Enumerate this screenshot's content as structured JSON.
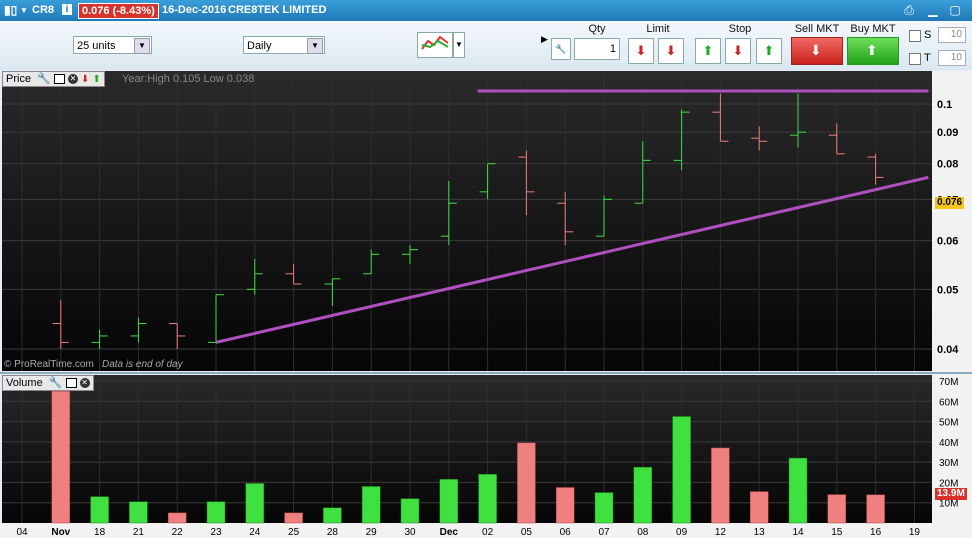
{
  "window": {
    "ticker": "CR8",
    "price_change": "0.076 (-8.43%)",
    "date": "16-Dec-2016",
    "company": "CRE8TEK LIMITED",
    "info_label": "i"
  },
  "toolbar": {
    "units_value": "25 units",
    "period_value": "Daily",
    "qty_label": "Qty",
    "qty_value": "1",
    "limit_label": "Limit",
    "stop_label": "Stop",
    "sell_label": "Sell MKT",
    "buy_label": "Buy MKT",
    "s_label": "S",
    "t_label": "T",
    "s_value": "10",
    "t_value": "10"
  },
  "price_panel": {
    "label": "Price",
    "year_info": "Year:High 0.105 Low 0.038",
    "footer": "© ProRealTime.com",
    "footer_note": "Data is end of day",
    "last_price_box": "0.076"
  },
  "volume_panel": {
    "label": "Volume",
    "last_volume_box": "13.9M"
  },
  "colors": {
    "up": "#3fe03f",
    "down": "#f08080",
    "trendline": "#b04fc0",
    "background": "#000000",
    "price_box": "#f5c518",
    "volume_box": "#d9322b"
  },
  "chart_data": {
    "type": "bar",
    "title": "",
    "x_ticks": [
      "04",
      "Nov",
      "18",
      "21",
      "22",
      "23",
      "24",
      "25",
      "28",
      "29",
      "30",
      "Dec",
      "02",
      "05",
      "06",
      "07",
      "08",
      "09",
      "12",
      "13",
      "14",
      "15",
      "16",
      "19"
    ],
    "price_ticks": [
      "0.04",
      "0.05",
      "0.06",
      "0.07",
      "0.08",
      "0.09",
      "0.1"
    ],
    "price_ylim": [
      0.037,
      0.11
    ],
    "price_scale": "log",
    "volume_ticks": [
      "10M",
      "20M",
      "30M",
      "40M",
      "50M",
      "60M",
      "70M"
    ],
    "volume_ylim": [
      0,
      70
    ],
    "volume_unit": "M",
    "bars": [
      {
        "date": "Nov",
        "open": 0.044,
        "high": 0.048,
        "low": 0.04,
        "close": 0.041,
        "volume": 65
      },
      {
        "date": "18",
        "open": 0.041,
        "high": 0.043,
        "low": 0.04,
        "close": 0.042,
        "volume": 13
      },
      {
        "date": "21",
        "open": 0.042,
        "high": 0.045,
        "low": 0.041,
        "close": 0.044,
        "volume": 10.5
      },
      {
        "date": "22",
        "open": 0.044,
        "high": 0.044,
        "low": 0.04,
        "close": 0.042,
        "volume": 5
      },
      {
        "date": "23",
        "open": 0.041,
        "high": 0.049,
        "low": 0.041,
        "close": 0.049,
        "volume": 10.5
      },
      {
        "date": "24",
        "open": 0.05,
        "high": 0.056,
        "low": 0.049,
        "close": 0.053,
        "volume": 19.5
      },
      {
        "date": "25",
        "open": 0.053,
        "high": 0.055,
        "low": 0.051,
        "close": 0.051,
        "volume": 5
      },
      {
        "date": "28",
        "open": 0.051,
        "high": 0.052,
        "low": 0.047,
        "close": 0.052,
        "volume": 7.5
      },
      {
        "date": "29",
        "open": 0.053,
        "high": 0.058,
        "low": 0.053,
        "close": 0.057,
        "volume": 18
      },
      {
        "date": "30",
        "open": 0.057,
        "high": 0.059,
        "low": 0.055,
        "close": 0.058,
        "volume": 12
      },
      {
        "date": "Dec",
        "open": 0.061,
        "high": 0.075,
        "low": 0.059,
        "close": 0.069,
        "volume": 21.5
      },
      {
        "date": "02",
        "open": 0.072,
        "high": 0.08,
        "low": 0.07,
        "close": 0.08,
        "volume": 24
      },
      {
        "date": "05",
        "open": 0.082,
        "high": 0.084,
        "low": 0.066,
        "close": 0.072,
        "volume": 39.5
      },
      {
        "date": "06",
        "open": 0.069,
        "high": 0.072,
        "low": 0.059,
        "close": 0.062,
        "volume": 17.5
      },
      {
        "date": "07",
        "open": 0.061,
        "high": 0.071,
        "low": 0.061,
        "close": 0.07,
        "volume": 15
      },
      {
        "date": "08",
        "open": 0.069,
        "high": 0.087,
        "low": 0.069,
        "close": 0.081,
        "volume": 27.5
      },
      {
        "date": "09",
        "open": 0.081,
        "high": 0.098,
        "low": 0.078,
        "close": 0.097,
        "volume": 52.5
      },
      {
        "date": "12",
        "open": 0.097,
        "high": 0.104,
        "low": 0.087,
        "close": 0.087,
        "volume": 37
      },
      {
        "date": "13",
        "open": 0.088,
        "high": 0.092,
        "low": 0.084,
        "close": 0.087,
        "volume": 15.5
      },
      {
        "date": "14",
        "open": 0.089,
        "high": 0.104,
        "low": 0.085,
        "close": 0.09,
        "volume": 32
      },
      {
        "date": "15",
        "open": 0.089,
        "high": 0.093,
        "low": 0.083,
        "close": 0.083,
        "volume": 14
      },
      {
        "date": "16",
        "open": 0.082,
        "high": 0.083,
        "low": 0.074,
        "close": 0.076,
        "volume": 13.9
      }
    ],
    "high_line": {
      "value": 0.105,
      "from": "02",
      "to": "19"
    },
    "trendline": {
      "from_date": "23",
      "from_value": 0.041,
      "to_date": "19",
      "to_value": 0.076
    }
  }
}
